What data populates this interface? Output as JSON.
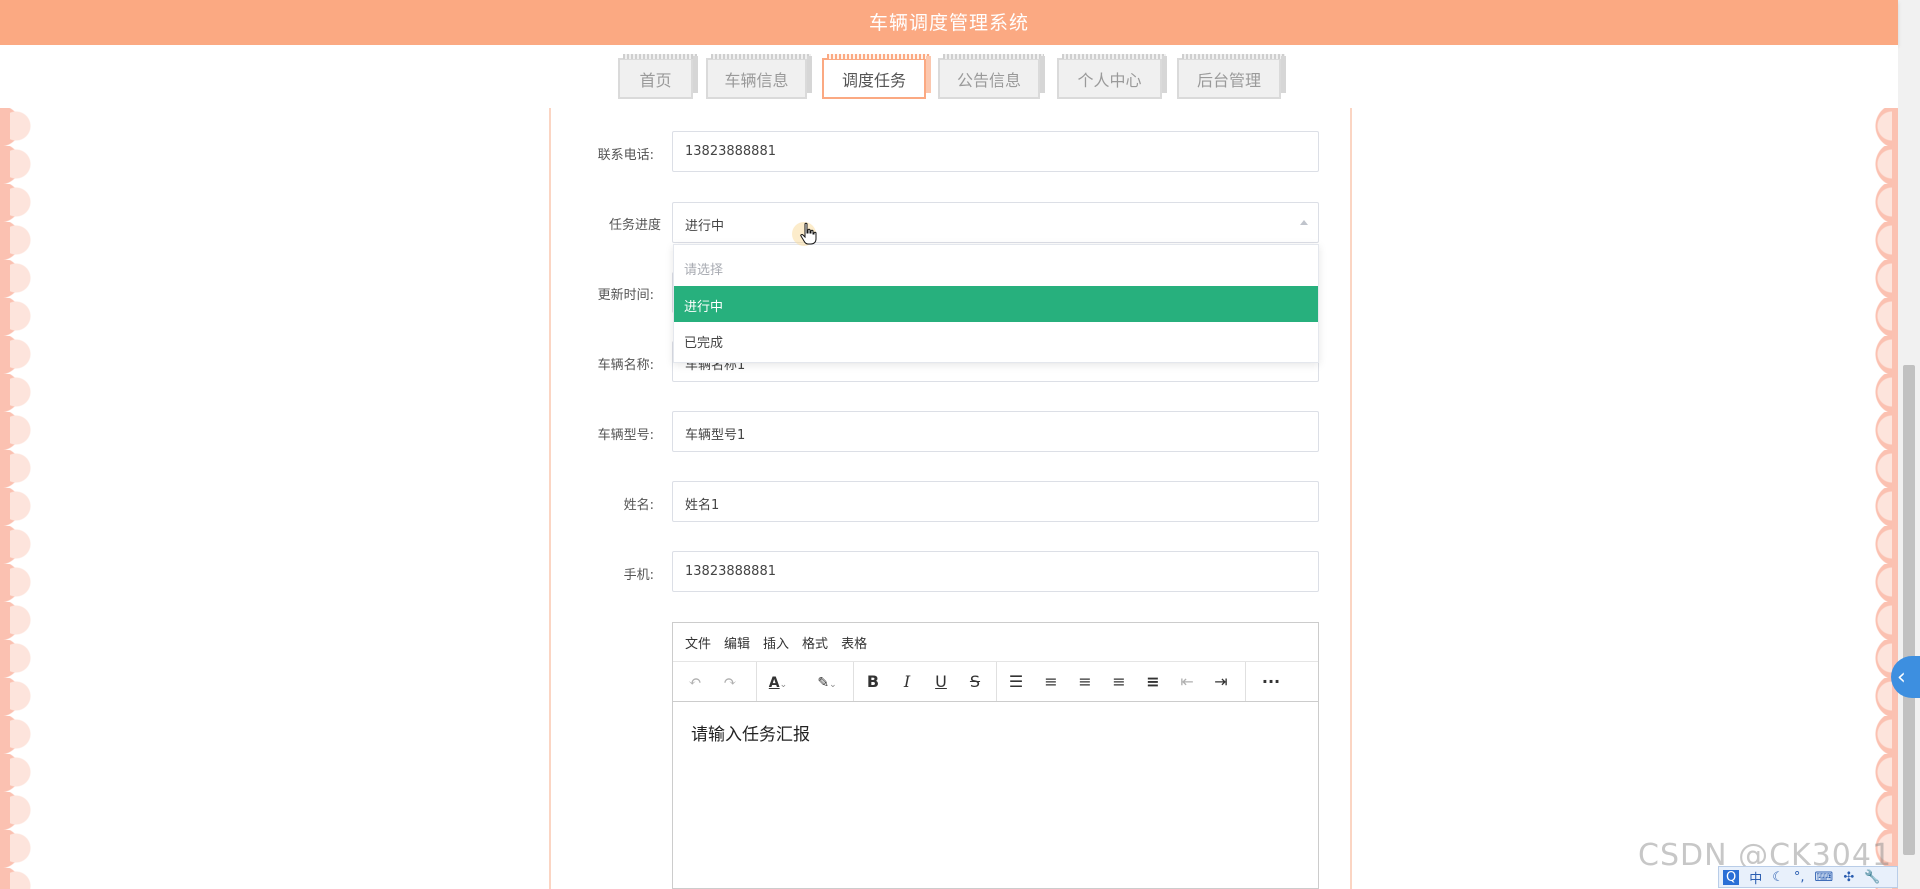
{
  "header": {
    "title": "车辆调度管理系统"
  },
  "nav": {
    "items": [
      {
        "label": "首页"
      },
      {
        "label": "车辆信息"
      },
      {
        "label": "调度任务"
      },
      {
        "label": "公告信息"
      },
      {
        "label": "个人中心"
      },
      {
        "label": "后台管理"
      }
    ],
    "active": "调度任务"
  },
  "form": {
    "contact_phone": {
      "label": "联系电话:",
      "value": "13823888881"
    },
    "task_progress": {
      "label": "任务进度",
      "value": "进行中"
    },
    "update_time": {
      "label": "更新时间:"
    },
    "vehicle_name": {
      "label": "车辆名称:",
      "value": "车辆名称1"
    },
    "vehicle_model": {
      "label": "车辆型号:",
      "value": "车辆型号1"
    },
    "name": {
      "label": "姓名:",
      "value": "姓名1"
    },
    "mobile": {
      "label": "手机:",
      "value": "13823888881"
    }
  },
  "dropdown": {
    "options": [
      {
        "label": "请选择",
        "placeholder": true
      },
      {
        "label": "进行中",
        "selected": true
      },
      {
        "label": "已完成"
      }
    ]
  },
  "editor": {
    "menu": [
      "文件",
      "编辑",
      "插入",
      "格式",
      "表格"
    ],
    "placeholder": "请输入任务汇报",
    "toolbar_icons": [
      "undo-icon",
      "redo-icon",
      "font-color-icon",
      "highlight-color-icon",
      "bold-icon",
      "italic-icon",
      "underline-icon",
      "strikethrough-icon",
      "line-height-icon",
      "align-left-icon",
      "align-center-icon",
      "align-right-icon",
      "align-justify-icon",
      "outdent-icon",
      "indent-icon",
      "more-icon"
    ]
  },
  "watermark": "CSDN @CK3041",
  "tray": {
    "q": "Q",
    "ime": "中"
  }
}
